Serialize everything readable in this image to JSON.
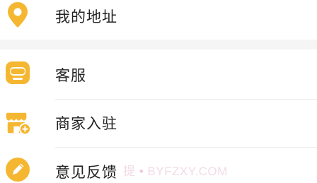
{
  "menu": {
    "items": [
      {
        "label": "我的地址",
        "icon": "location-pin-icon"
      },
      {
        "label": "客服",
        "icon": "customer-service-headset-icon"
      },
      {
        "label": "商家入驻",
        "icon": "store-add-icon"
      },
      {
        "label": "意见反馈",
        "icon": "pencil-feedback-icon"
      }
    ]
  },
  "watermark": {
    "text_left": "提",
    "dot": "•",
    "text_right": "BYFZXY.COM"
  },
  "colors": {
    "icon_accent": "#F5B731",
    "background": "#FFFFFF",
    "separator": "#F5F5F5",
    "text": "#222222"
  }
}
